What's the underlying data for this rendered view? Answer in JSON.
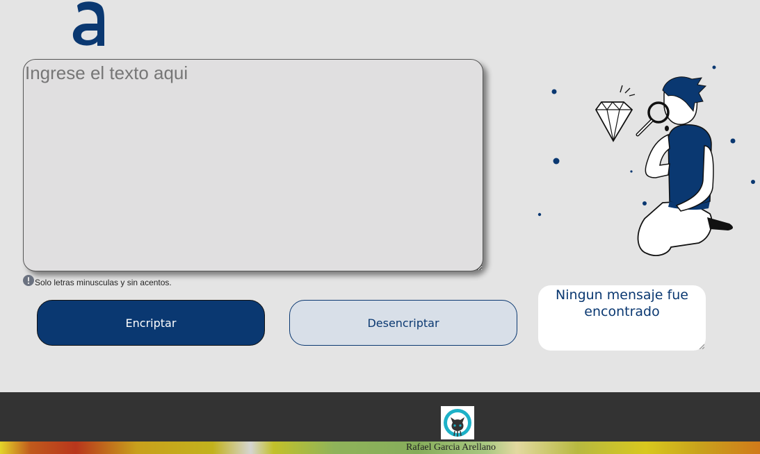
{
  "brand": {
    "logo_icon": "alura-a-logo-icon",
    "accent": "#0a3871"
  },
  "input": {
    "placeholder": "Ingrese el texto aqui",
    "value": ""
  },
  "hint": {
    "icon": "exclamation-circle-icon",
    "text": "Solo letras minusculas y sin acentos."
  },
  "buttons": {
    "encrypt": "Encriptar",
    "decrypt": "Desencriptar"
  },
  "output": {
    "message": "Ningun mensaje fue encontrado"
  },
  "illustration": {
    "icon": "man-with-magnifying-glass-diamond-icon"
  },
  "footer": {
    "github_icon": "github-octocat-icon",
    "author": "Rafael Garcia Arellano"
  }
}
